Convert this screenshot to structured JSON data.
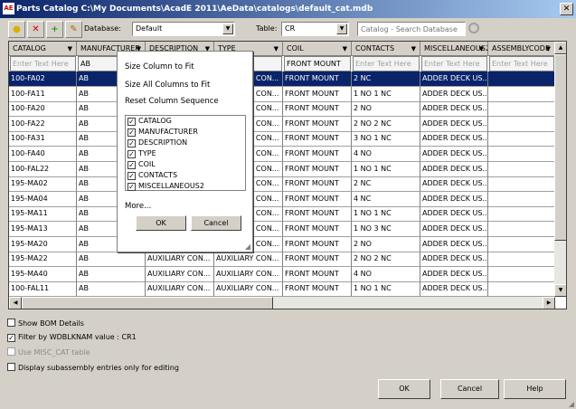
{
  "window": {
    "title": "Parts Catalog C:\\My Documents\\AcadE 2011\\AeData\\catalogs\\default_cat.mdb",
    "icon_label": "AE",
    "close": "✕"
  },
  "toolbar": {
    "database_label": "Database:",
    "database_value": "Default",
    "table_label": "Table:",
    "table_value": "CR",
    "search_placeholder": "Catalog - Search Database"
  },
  "grid": {
    "columns": [
      "CATALOG",
      "MANUFACTURER",
      "DESCRIPTION",
      "TYPE",
      "COIL",
      "CONTACTS",
      "MISCELLANEOUS2",
      "ASSEMBLYCODE"
    ],
    "filters": [
      "Enter Text Here",
      "AB",
      "",
      "CONTACT",
      "FRONT MOUNT",
      "Enter Text Here",
      "Enter Text Here",
      "Enter Text Here"
    ],
    "selected_row": 0,
    "rows": [
      [
        "100-FA02",
        "AB",
        "AUXILIARY CON...",
        "AUXILIARY CON...",
        "FRONT MOUNT",
        "2 NC",
        "ADDER DECK US...",
        ""
      ],
      [
        "100-FA11",
        "AB",
        "AUXILIARY CON...",
        "AUXILIARY CON...",
        "FRONT MOUNT",
        "1 NO 1 NC",
        "ADDER DECK US...",
        ""
      ],
      [
        "100-FA20",
        "AB",
        "AUXILIARY CON...",
        "AUXILIARY CON...",
        "FRONT MOUNT",
        "2 NO",
        "ADDER DECK US...",
        ""
      ],
      [
        "100-FA22",
        "AB",
        "AUXILIARY CON...",
        "AUXILIARY CON...",
        "FRONT MOUNT",
        "2 NO 2 NC",
        "ADDER DECK US...",
        ""
      ],
      [
        "100-FA31",
        "AB",
        "AUXILIARY CON...",
        "AUXILIARY CON...",
        "FRONT MOUNT",
        "3 NO 1 NC",
        "ADDER DECK US...",
        ""
      ],
      [
        "100-FA40",
        "AB",
        "AUXILIARY CON...",
        "AUXILIARY CON...",
        "FRONT MOUNT",
        "4 NO",
        "ADDER DECK US...",
        ""
      ],
      [
        "100-FAL22",
        "AB",
        "AUXILIARY CON...",
        "AUXILIARY CON...",
        "FRONT MOUNT",
        "1 NO 1 NC",
        "ADDER DECK US...",
        ""
      ],
      [
        "195-MA02",
        "AB",
        "AUXILIARY CON...",
        "AUXILIARY CON...",
        "FRONT MOUNT",
        "2 NC",
        "ADDER DECK US...",
        ""
      ],
      [
        "195-MA04",
        "AB",
        "AUXILIARY CON...",
        "AUXILIARY CON...",
        "FRONT MOUNT",
        "4 NC",
        "ADDER DECK US...",
        ""
      ],
      [
        "195-MA11",
        "AB",
        "AUXILIARY CON...",
        "AUXILIARY CON...",
        "FRONT MOUNT",
        "1 NO 1 NC",
        "ADDER DECK US...",
        ""
      ],
      [
        "195-MA13",
        "AB",
        "AUXILIARY CON...",
        "AUXILIARY CON...",
        "FRONT MOUNT",
        "1 NO 3 NC",
        "ADDER DECK US...",
        ""
      ],
      [
        "195-MA20",
        "AB",
        "AUXILIARY CON...",
        "AUXILIARY CON...",
        "FRONT MOUNT",
        "2 NO",
        "ADDER DECK US...",
        ""
      ],
      [
        "195-MA22",
        "AB",
        "AUXILIARY CON...",
        "AUXILIARY CON...",
        "FRONT MOUNT",
        "2 NO 2 NC",
        "ADDER DECK US...",
        ""
      ],
      [
        "195-MA40",
        "AB",
        "AUXILIARY CON...",
        "AUXILIARY CON...",
        "FRONT MOUNT",
        "4 NO",
        "ADDER DECK US...",
        ""
      ],
      [
        "100-FAL11",
        "AB",
        "AUXILIARY CON...",
        "AUXILIARY CON...",
        "FRONT MOUNT",
        "1 NO 1 NC",
        "ADDER DECK US...",
        ""
      ]
    ]
  },
  "popup": {
    "size_column": "Size Column to Fit",
    "size_all": "Size All Columns to Fit",
    "reset": "Reset Column Sequence",
    "columns": [
      {
        "label": "CATALOG",
        "checked": true
      },
      {
        "label": "MANUFACTURER",
        "checked": true
      },
      {
        "label": "DESCRIPTION",
        "checked": true
      },
      {
        "label": "TYPE",
        "checked": true
      },
      {
        "label": "COIL",
        "checked": true
      },
      {
        "label": "CONTACTS",
        "checked": true
      },
      {
        "label": "MISCELLANEOUS2",
        "checked": true
      }
    ],
    "more": "More...",
    "ok": "OK",
    "cancel": "Cancel"
  },
  "options": [
    {
      "label": "Show BOM Details",
      "checked": false,
      "enabled": true
    },
    {
      "label": "Filter by WDBLKNAM value : CR1",
      "checked": true,
      "enabled": true
    },
    {
      "label": "Use MISC_CAT table",
      "checked": false,
      "enabled": false
    },
    {
      "label": "Display subassembly entries only for editing",
      "checked": false,
      "enabled": true
    }
  ],
  "buttons": {
    "ok": "OK",
    "cancel": "Cancel",
    "help": "Help"
  },
  "colors": {
    "selection": "#0a246a",
    "title_bar": "#0a246a",
    "face": "#d4d0c8"
  }
}
